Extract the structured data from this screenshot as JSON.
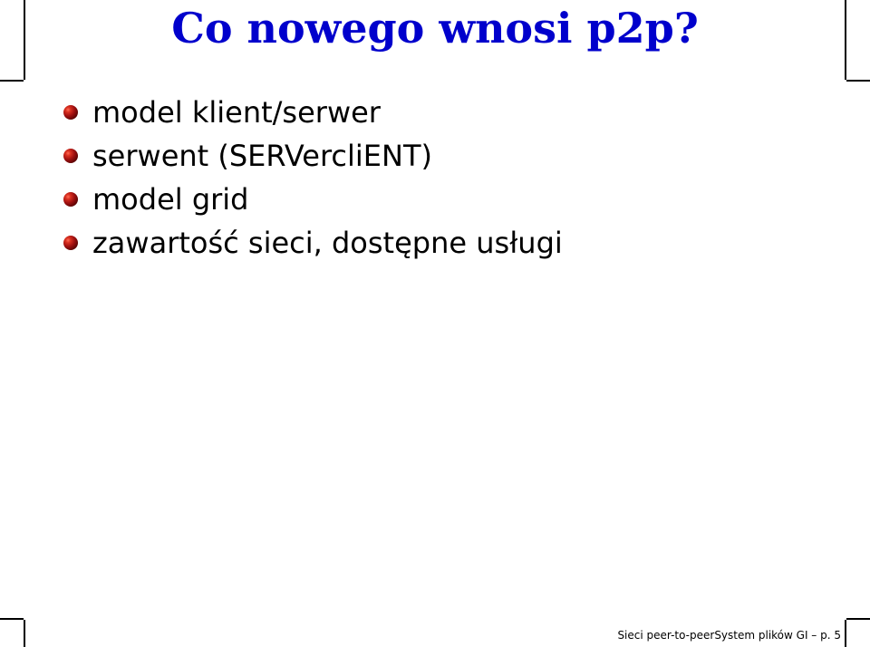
{
  "title": "Co nowego wnosi p2p?",
  "bullets": [
    "model klient/serwer",
    "serwent (SERVercliENT)",
    "model grid",
    "zawartość sieci, dostępne usługi"
  ],
  "footer": "Sieci peer-to-peerSystem plików GI – p. 5"
}
